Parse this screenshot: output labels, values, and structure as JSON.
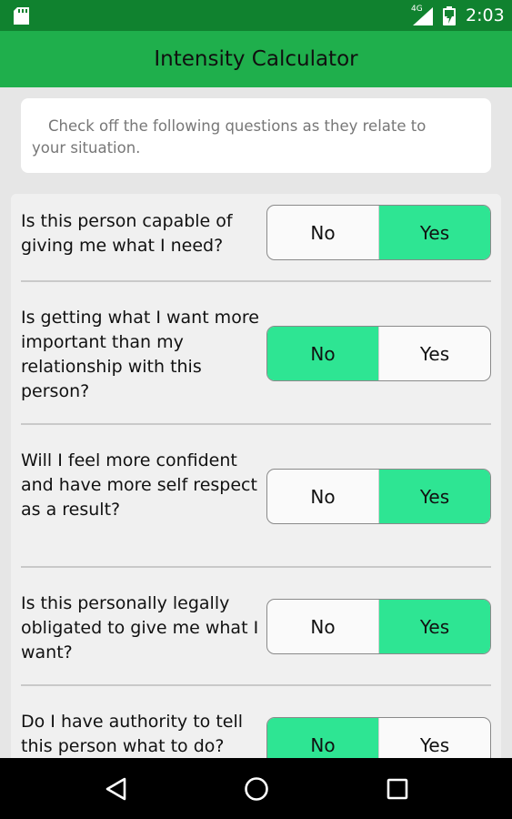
{
  "status_bar": {
    "network": "4G",
    "time": "2:03",
    "icons": [
      "sd-card-icon",
      "signal-icon",
      "battery-icon"
    ]
  },
  "app_bar": {
    "title": "Intensity Calculator"
  },
  "intro": {
    "text": "Check off the following questions as they relate to your situation."
  },
  "questions": [
    {
      "text": "Is this person capable of giving me what I need?",
      "no_label": "No",
      "yes_label": "Yes",
      "selected": "Yes"
    },
    {
      "text": "Is getting what I want more important than my relationship with this person?",
      "no_label": "No",
      "yes_label": "Yes",
      "selected": "No"
    },
    {
      "text": "Will I feel more confident and have more self respect as a result?",
      "no_label": "No",
      "yes_label": "Yes",
      "selected": "Yes"
    },
    {
      "text": "Is this personally legally obligated to give me what I want?",
      "no_label": "No",
      "yes_label": "Yes",
      "selected": "Yes"
    },
    {
      "text": "Do I have authority to tell this person what to do?",
      "no_label": "No",
      "yes_label": "Yes",
      "selected": "No"
    }
  ],
  "colors": {
    "status_bar": "#10822f",
    "app_bar": "#1faf4c",
    "selected_option": "#2ee593",
    "panel": "#f0f0f0"
  },
  "nav_bar": {
    "icons": [
      "back-icon",
      "home-icon",
      "recents-icon"
    ]
  }
}
